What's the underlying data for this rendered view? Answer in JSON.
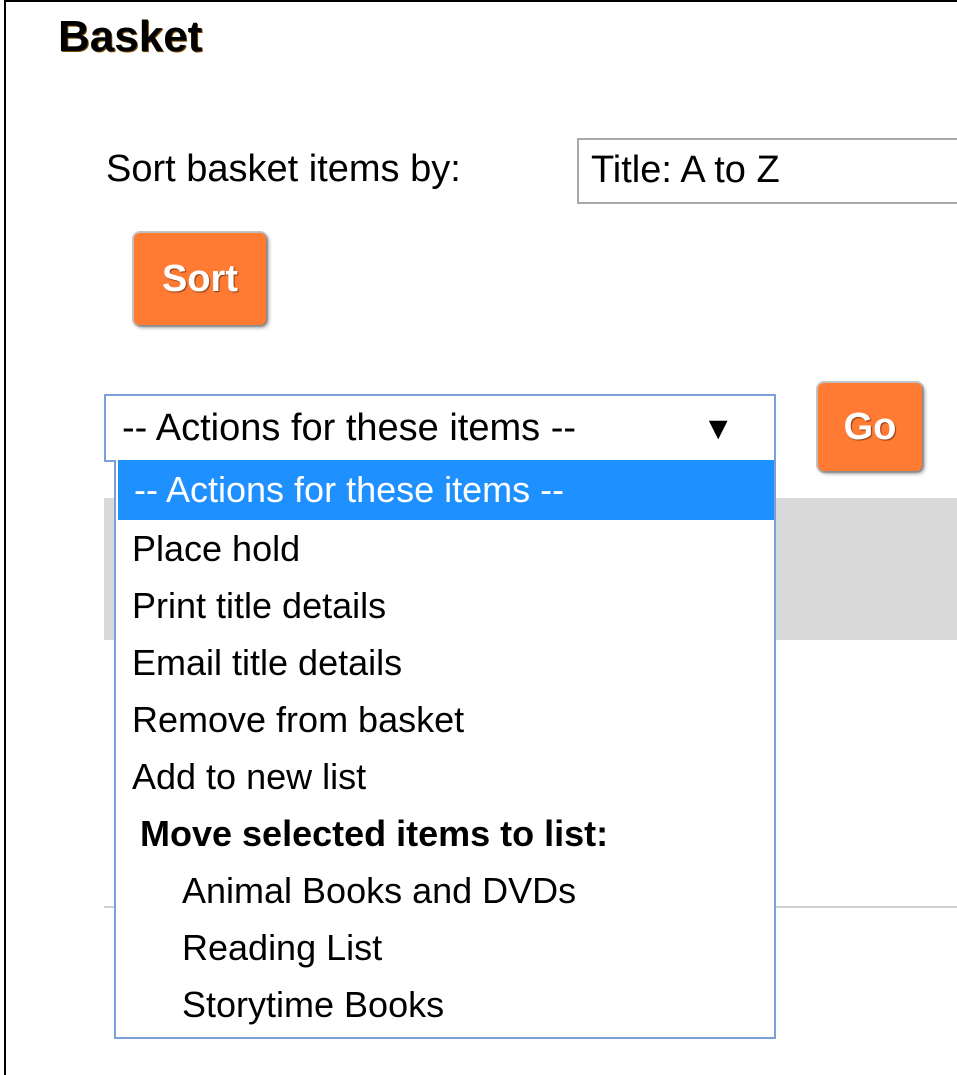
{
  "page": {
    "title": "Basket"
  },
  "sort": {
    "label": "Sort basket items by:",
    "selected": "Title: A to Z",
    "button": "Sort"
  },
  "actions": {
    "selected": "-- Actions for these items --",
    "arrow": "▼",
    "go_button": "Go",
    "options": [
      "-- Actions for these items --",
      "Place hold",
      "Print title details",
      "Email title details",
      "Remove from basket",
      "Add to new list"
    ],
    "group_label": "Move selected items to list:",
    "lists": [
      "Animal Books and DVDs",
      "Reading List",
      "Storytime Books"
    ]
  }
}
